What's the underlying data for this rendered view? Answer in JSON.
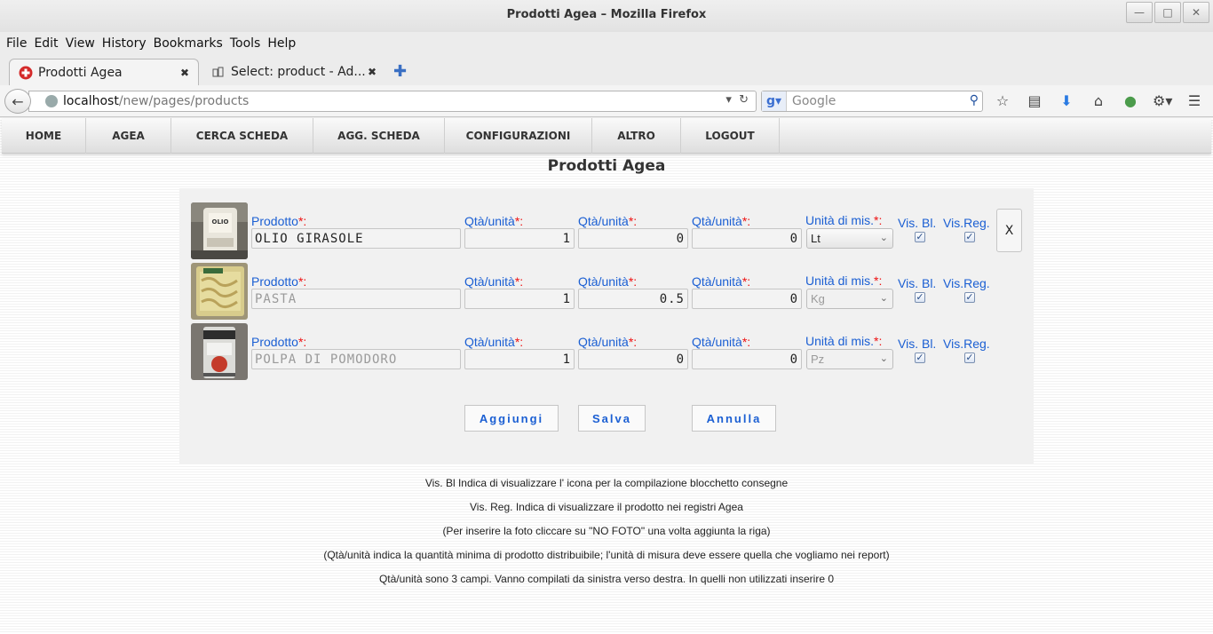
{
  "window": {
    "title": "Prodotti Agea – Mozilla Firefox"
  },
  "menubar": [
    "File",
    "Edit",
    "View",
    "History",
    "Bookmarks",
    "Tools",
    "Help"
  ],
  "tabs": [
    {
      "label": "Prodotti Agea",
      "active": true
    },
    {
      "label": "Select: product - Ad...",
      "active": false
    }
  ],
  "navbar": {
    "url_host": "localhost",
    "url_path": "/new/pages/products",
    "search_placeholder": "Google"
  },
  "site_nav": [
    "HOME",
    "AGEA",
    "CERCA SCHEDA",
    "AGG. SCHEDA",
    "CONFIGURAZIONI",
    "ALTRO",
    "LOGOUT"
  ],
  "page": {
    "title": "Prodotti Agea"
  },
  "form": {
    "labels": {
      "product": "Prodotto",
      "qty": "Qtà/unità",
      "unit": "Unità di mis.",
      "required": "*:",
      "vis_bl": "Vis. Bl.",
      "vis_reg": "Vis.Reg."
    },
    "rows": [
      {
        "product": "OLIO GIRASOLE",
        "qty1": "1",
        "qty2": "0",
        "qty3": "0",
        "unit": "Lt",
        "vis_bl": true,
        "vis_reg": true,
        "editable": true,
        "photo": "oil-bottle"
      },
      {
        "product": "PASTA",
        "qty1": "1",
        "qty2": "0.5",
        "qty3": "0",
        "unit": "Kg",
        "vis_bl": true,
        "vis_reg": true,
        "editable": false,
        "photo": "pasta-pack"
      },
      {
        "product": "POLPA DI POMODORO",
        "qty1": "1",
        "qty2": "0",
        "qty3": "0",
        "unit": "Pz",
        "vis_bl": true,
        "vis_reg": true,
        "editable": false,
        "photo": "tomato-can"
      }
    ],
    "delete_label": "X",
    "buttons": {
      "add": "Aggiungi",
      "save": "Salva",
      "cancel": "Annulla"
    }
  },
  "notes": [
    "Vis. Bl Indica di visualizzare l' icona per la compilazione blocchetto consegne",
    "Vis. Reg. Indica di visualizzare il prodotto nei registri Agea",
    "(Per inserire la foto cliccare su \"NO FOTO\" una volta aggiunta la riga)",
    "(Qtà/unità indica la quantità minima di prodotto distribuibile; l'unità di misura deve essere quella che vogliamo nei report)",
    "Qtà/unità sono 3 campi. Vanno compilati da sinistra verso destra. In quelli non utilizzati inserire 0"
  ],
  "colors": {
    "label_blue": "#1b5fd3",
    "required_red": "#e11111"
  }
}
